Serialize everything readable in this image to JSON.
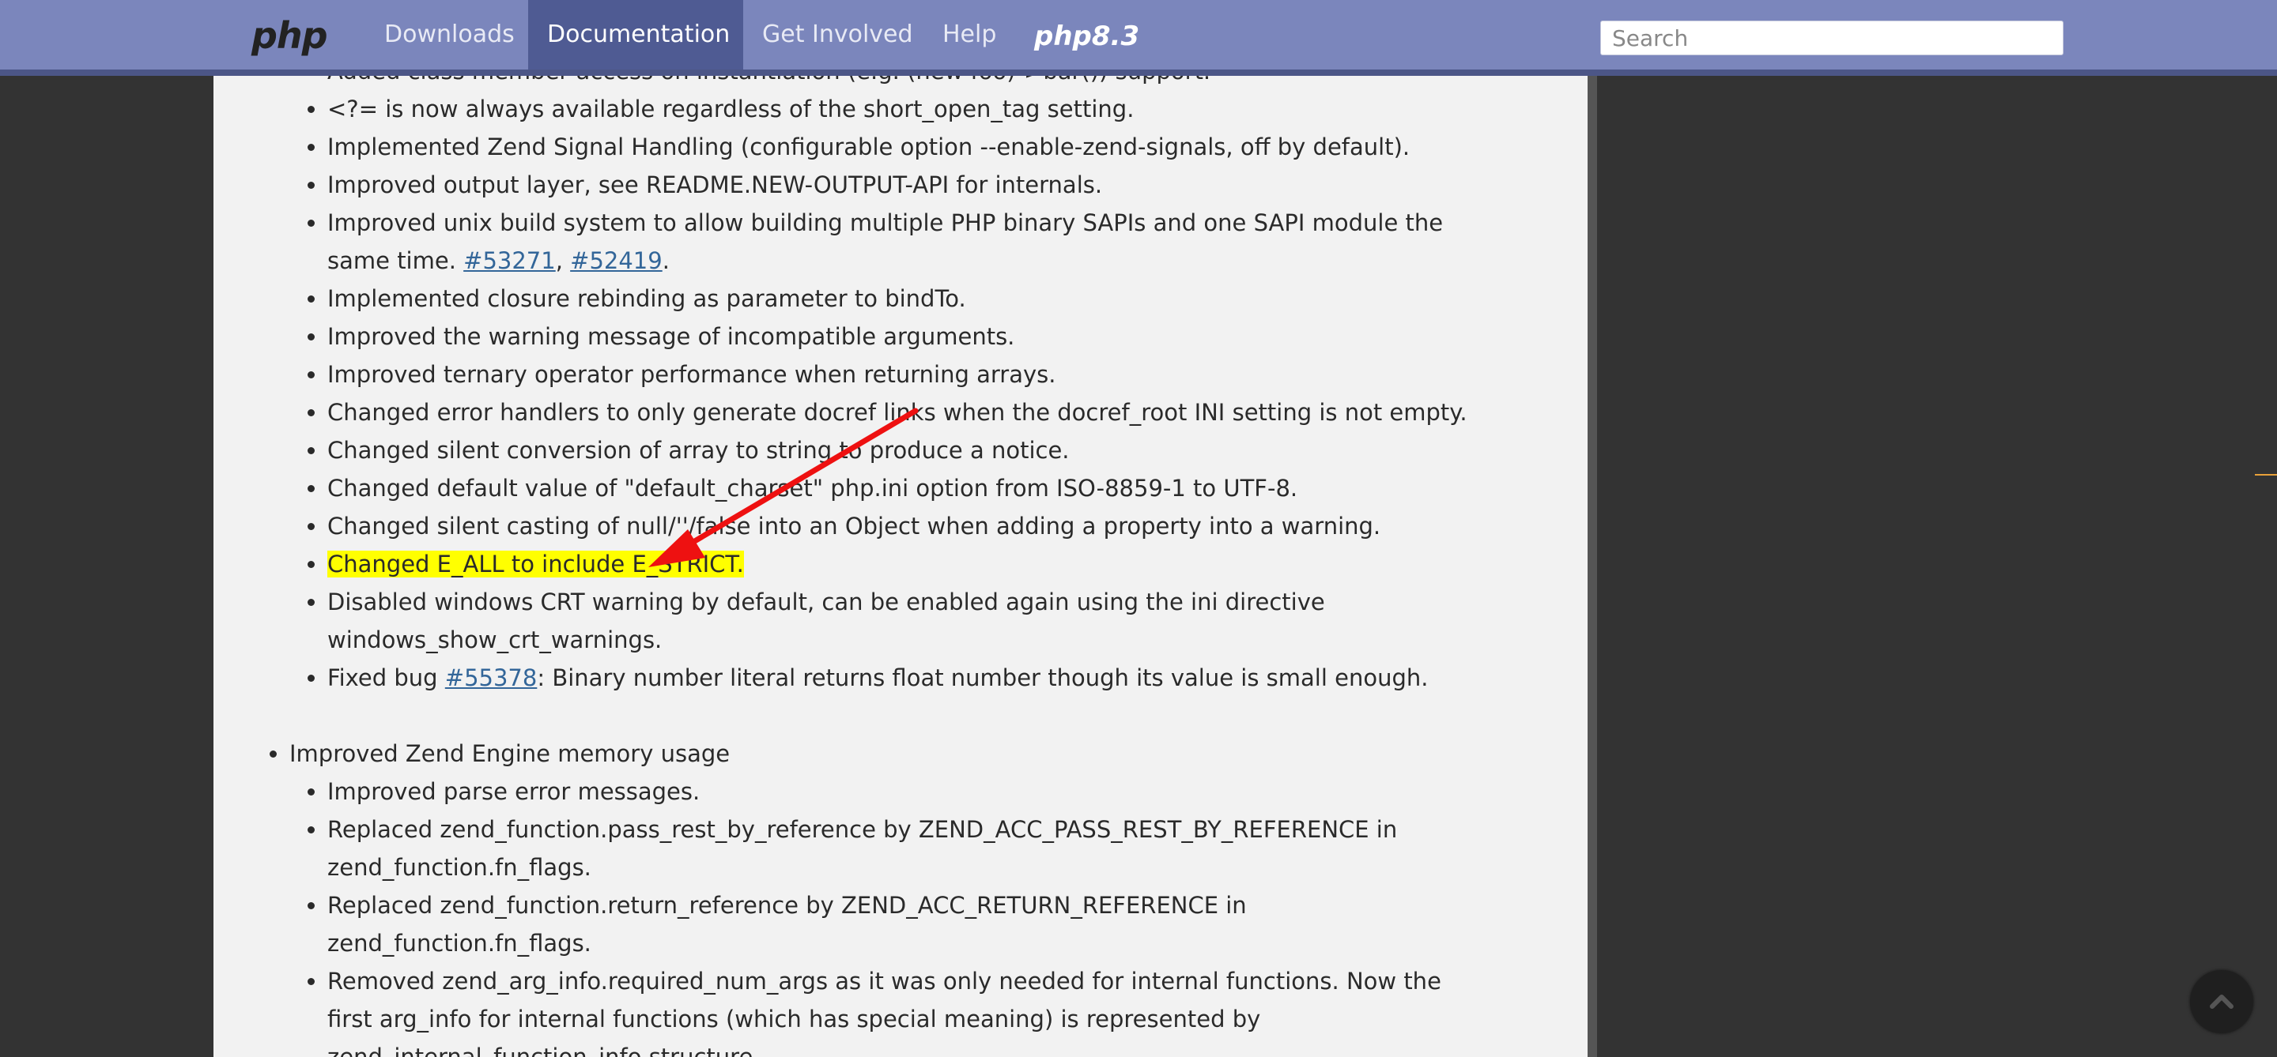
{
  "nav": {
    "logo": "php",
    "items": [
      {
        "label": "Downloads"
      },
      {
        "label": "Documentation",
        "active": true
      },
      {
        "label": "Get Involved"
      },
      {
        "label": "Help"
      }
    ],
    "version_logo": "php8.3",
    "search_placeholder": "Search"
  },
  "content": {
    "group1": [
      {
        "text": "Added class member access on instantiation (e.g. (new foo)->bar()) support."
      },
      {
        "text": "<?= is now always available regardless of the short_open_tag setting."
      },
      {
        "text": "Implemented Zend Signal Handling (configurable option --enable-zend-signals, off by default)."
      },
      {
        "text": "Improved output layer, see README.NEW-OUTPUT-API for internals."
      },
      {
        "before": "Improved unix build system to allow building multiple PHP binary SAPIs and one SAPI module the same time. ",
        "link1": "#53271",
        "sep": ", ",
        "link2": "#52419",
        "after": "."
      },
      {
        "text": "Implemented closure rebinding as parameter to bindTo."
      },
      {
        "text": "Improved the warning message of incompatible arguments."
      },
      {
        "text": "Improved ternary operator performance when returning arrays."
      },
      {
        "text": "Changed error handlers to only generate docref links when the docref_root INI setting is not empty."
      },
      {
        "text": "Changed silent conversion of array to string to produce a notice."
      },
      {
        "text": "Changed default value of \"default_charset\" php.ini option from ISO-8859-1 to UTF-8."
      },
      {
        "text": "Changed silent casting of null/''/false into an Object when adding a property into a warning."
      },
      {
        "text": "Changed E_ALL to include E_STRICT.",
        "highlighted": true
      },
      {
        "text": "Disabled windows CRT warning by default, can be enabled again using the ini directive windows_show_crt_warnings."
      },
      {
        "before": "Fixed bug ",
        "link": "#55378",
        "after": ": Binary number literal returns float number though its value is small enough."
      }
    ],
    "section2_title": "Improved Zend Engine memory usage",
    "group2": [
      {
        "text": "Improved parse error messages."
      },
      {
        "text": "Replaced zend_function.pass_rest_by_reference by ZEND_ACC_PASS_REST_BY_REFERENCE in zend_function.fn_flags."
      },
      {
        "text": "Replaced zend_function.return_reference by ZEND_ACC_RETURN_REFERENCE in zend_function.fn_flags."
      },
      {
        "text": "Removed zend_arg_info.required_num_args as it was only needed for internal functions. Now the first arg_info for internal functions (which has special meaning) is represented by zend_internal_function_info structure."
      }
    ]
  },
  "colors": {
    "navbar": "#7b86bc",
    "nav_active": "#4f5b93",
    "highlight": "#ffff00",
    "link": "#336699",
    "arrow": "#ee1111"
  }
}
